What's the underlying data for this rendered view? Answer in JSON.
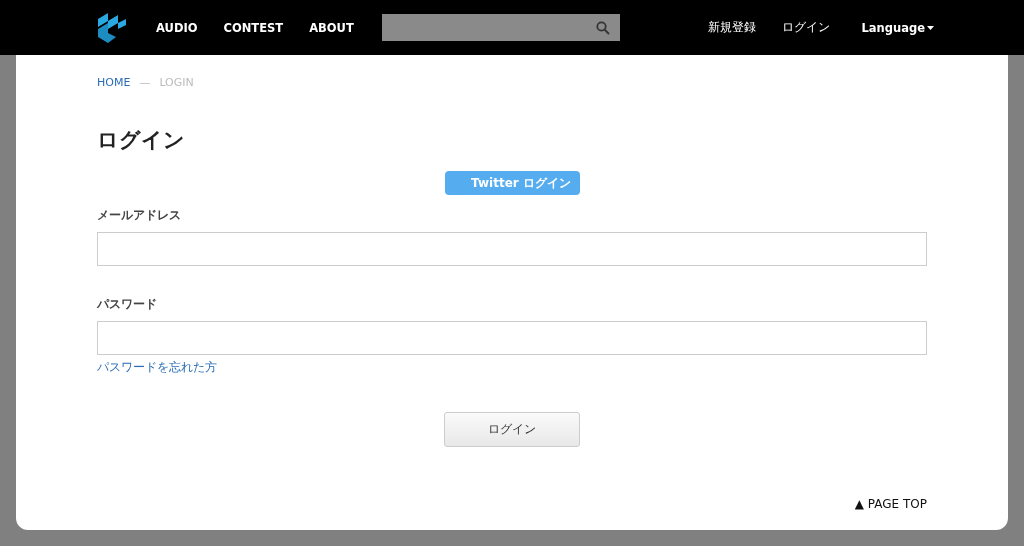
{
  "nav": {
    "links": [
      "AUDIO",
      "CONTEST",
      "ABOUT"
    ],
    "right": [
      "新規登録",
      "ログイン"
    ],
    "language": "Language"
  },
  "breadcrumb": {
    "items": [
      "HOME",
      "LOGIN"
    ],
    "separator": "—"
  },
  "title": "ログイン",
  "twitter_button": "Twitter ログイン",
  "fields": [
    {
      "label": "メールアドレス"
    },
    {
      "label": "パスワード"
    }
  ],
  "forgot_link": "パスワードを忘れた方",
  "submit": "ログイン",
  "page_top": "▲ PAGE TOP"
}
